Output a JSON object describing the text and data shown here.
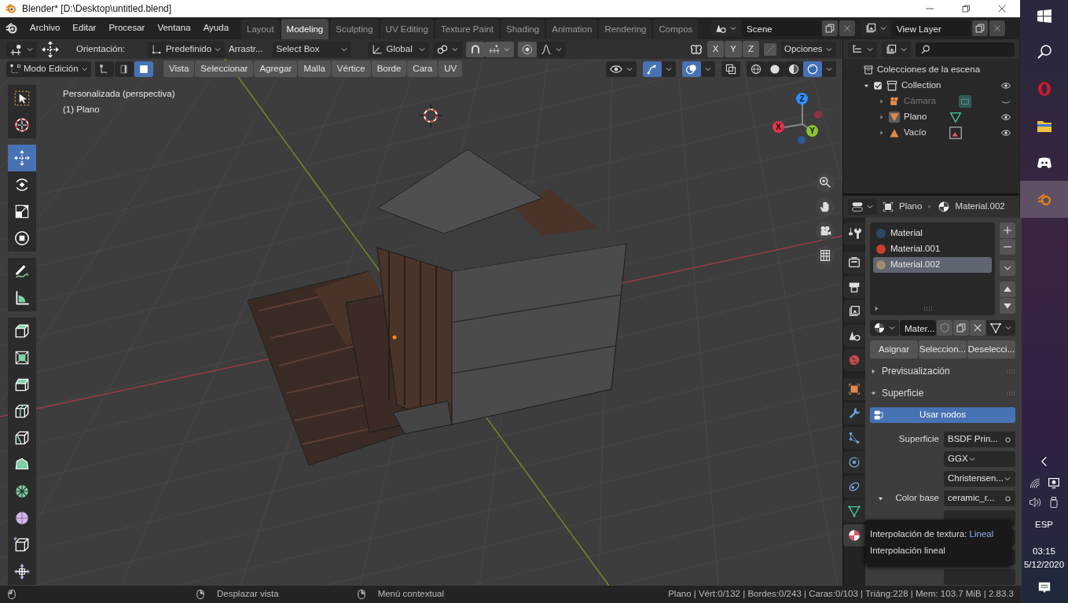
{
  "window": {
    "title": "Blender* [D:\\Desktop\\untitled.blend]"
  },
  "menu": [
    "Archivo",
    "Editar",
    "Procesar",
    "Ventana",
    "Ayuda"
  ],
  "workspaces": [
    {
      "label": "Layout",
      "selected": false
    },
    {
      "label": "Modeling",
      "selected": true
    },
    {
      "label": "Sculpting",
      "selected": false
    },
    {
      "label": "UV Editing",
      "selected": false
    },
    {
      "label": "Texture Paint",
      "selected": false
    },
    {
      "label": "Shading",
      "selected": false
    },
    {
      "label": "Animation",
      "selected": false
    },
    {
      "label": "Rendering",
      "selected": false
    },
    {
      "label": "Compos",
      "selected": false
    }
  ],
  "scene": "Scene",
  "view_layer": "View Layer",
  "tool_settings": {
    "orientation_label": "Orientación:",
    "pivot": "Predefinido",
    "drag": "Arrastr...",
    "select": "Select Box",
    "orientation": "Global",
    "mirror": [
      {
        "label": "X",
        "on": false
      },
      {
        "label": "Y",
        "on": false
      },
      {
        "label": "Z",
        "on": false
      }
    ],
    "options": "Opciones"
  },
  "mode": "Modo Edición",
  "select_modes": [
    {
      "kind": "vertex",
      "selected": false
    },
    {
      "kind": "edge",
      "selected": false
    },
    {
      "kind": "face",
      "selected": true
    }
  ],
  "edit_menus": [
    "Vista",
    "Seleccionar",
    "Agregar",
    "Malla",
    "Vértice",
    "Borde",
    "Cara",
    "UV"
  ],
  "viewport_toggles": {
    "gizmos": true,
    "overlays": true,
    "xray": false
  },
  "shading": [
    {
      "kind": "wireframe",
      "selected": false
    },
    {
      "kind": "solid",
      "selected": false
    },
    {
      "kind": "material",
      "selected": false
    },
    {
      "kind": "rendered",
      "selected": true
    }
  ],
  "viewport": {
    "view_name": "Personalizada (perspectiva)",
    "object_name": "(1) Plano",
    "gizmo": [
      {
        "label": "X",
        "color": "#e0344c"
      },
      {
        "label": "Y",
        "color": "#8ac530"
      },
      {
        "label": "Z",
        "color": "#2c8fff"
      }
    ]
  },
  "tools": [
    {
      "kind": "select",
      "selected": false
    },
    {
      "kind": "cursor",
      "selected": false
    },
    {
      "kind": "move",
      "selected": true
    },
    {
      "kind": "rotate",
      "selected": false
    },
    {
      "kind": "scale",
      "selected": false
    },
    {
      "kind": "transform",
      "selected": false
    },
    {
      "kind": "annotate",
      "selected": false
    },
    {
      "kind": "measure",
      "selected": false
    },
    {
      "kind": "extrude",
      "selected": false
    },
    {
      "kind": "inset",
      "selected": false
    },
    {
      "kind": "bevel",
      "selected": false
    },
    {
      "kind": "loopcut",
      "selected": false
    },
    {
      "kind": "knife",
      "selected": false
    },
    {
      "kind": "polybuild",
      "selected": false
    },
    {
      "kind": "spin",
      "selected": false
    },
    {
      "kind": "smooth",
      "selected": false
    },
    {
      "kind": "shrink",
      "selected": false
    },
    {
      "kind": "push",
      "selected": false
    }
  ],
  "outliner": {
    "title": "Colecciones de la escena",
    "items": [
      {
        "label": "Collection",
        "kind": "collection",
        "checked": true,
        "visible": true,
        "children": [
          {
            "label": "Cámara",
            "kind": "camera",
            "visible": false
          },
          {
            "label": "Plano",
            "kind": "mesh",
            "visible": true
          },
          {
            "label": "Vacío",
            "kind": "image",
            "visible": true
          }
        ]
      }
    ]
  },
  "properties": {
    "object": "Plano",
    "material": "Material.002",
    "tabs": [
      {
        "kind": "tool",
        "selected": false
      },
      {
        "kind": "render",
        "selected": false
      },
      {
        "kind": "output",
        "selected": false
      },
      {
        "kind": "view_layer",
        "selected": false
      },
      {
        "kind": "scene",
        "selected": false
      },
      {
        "kind": "world",
        "selected": false
      },
      {
        "kind": "object",
        "selected": false
      },
      {
        "kind": "modifiers",
        "selected": false
      },
      {
        "kind": "particles",
        "selected": false
      },
      {
        "kind": "physics",
        "selected": false
      },
      {
        "kind": "constraints",
        "selected": false
      },
      {
        "kind": "data",
        "selected": false
      },
      {
        "kind": "material",
        "selected": true
      }
    ],
    "slots": [
      {
        "name": "Material",
        "color": "#2b4866",
        "selected": false
      },
      {
        "name": "Material.001",
        "color": "#c8402c",
        "selected": false
      },
      {
        "name": "Material.002",
        "color": "#a08a68",
        "selected": true
      }
    ],
    "datablock": "Mater...",
    "slot_buttons": [
      "Asignar",
      "Seleccion...",
      "Deselecci..."
    ],
    "panels": [
      {
        "title": "Previsualización",
        "expanded": false
      },
      {
        "title": "Superficie",
        "expanded": true
      }
    ],
    "use_nodes": "Usar nodos",
    "fields": [
      {
        "kind": "link",
        "label": "Superficie",
        "value": "BSDF Prin..."
      },
      {
        "kind": "dropdown",
        "value": "GGX"
      },
      {
        "kind": "dropdown",
        "value": "Christensen..."
      },
      {
        "kind": "link",
        "label": "Color base",
        "value": "ceramic_r...",
        "expanded": true
      }
    ],
    "tooltip": {
      "title": "Interpolación de textura:",
      "value": "Lineal",
      "description": "Interpolación lineal"
    }
  },
  "status_bar": {
    "hints": [
      "Desplazar vista",
      "Menú contextual"
    ],
    "stats": "Plano | Vért:0/132 | Bordes:0/243 | Caras:0/103 | Triáng:228 | Mem: 103.7 MiB | 2.83.3"
  },
  "taskbar": {
    "apps": [
      {
        "kind": "opera",
        "selected": false
      },
      {
        "kind": "explorer",
        "selected": false
      },
      {
        "kind": "discord",
        "selected": false
      },
      {
        "kind": "blender",
        "selected": true
      }
    ],
    "language": "ESP",
    "time": "03:15",
    "date": "5/12/2020"
  }
}
